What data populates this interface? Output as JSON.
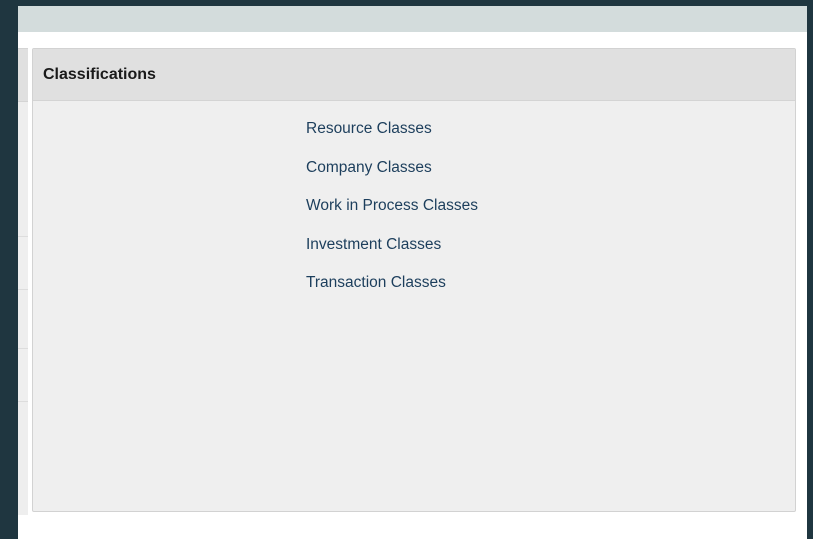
{
  "panel": {
    "title": "Classifications",
    "links": [
      "Resource Classes",
      "Company Classes",
      "Work in Process Classes",
      "Investment Classes",
      "Transaction Classes"
    ]
  },
  "colors": {
    "background": "#1f3640",
    "top_strip": "#d3dcdc",
    "panel_body": "#efefef",
    "panel_header": "#e0e0e0",
    "link": "#1c3e5c"
  }
}
